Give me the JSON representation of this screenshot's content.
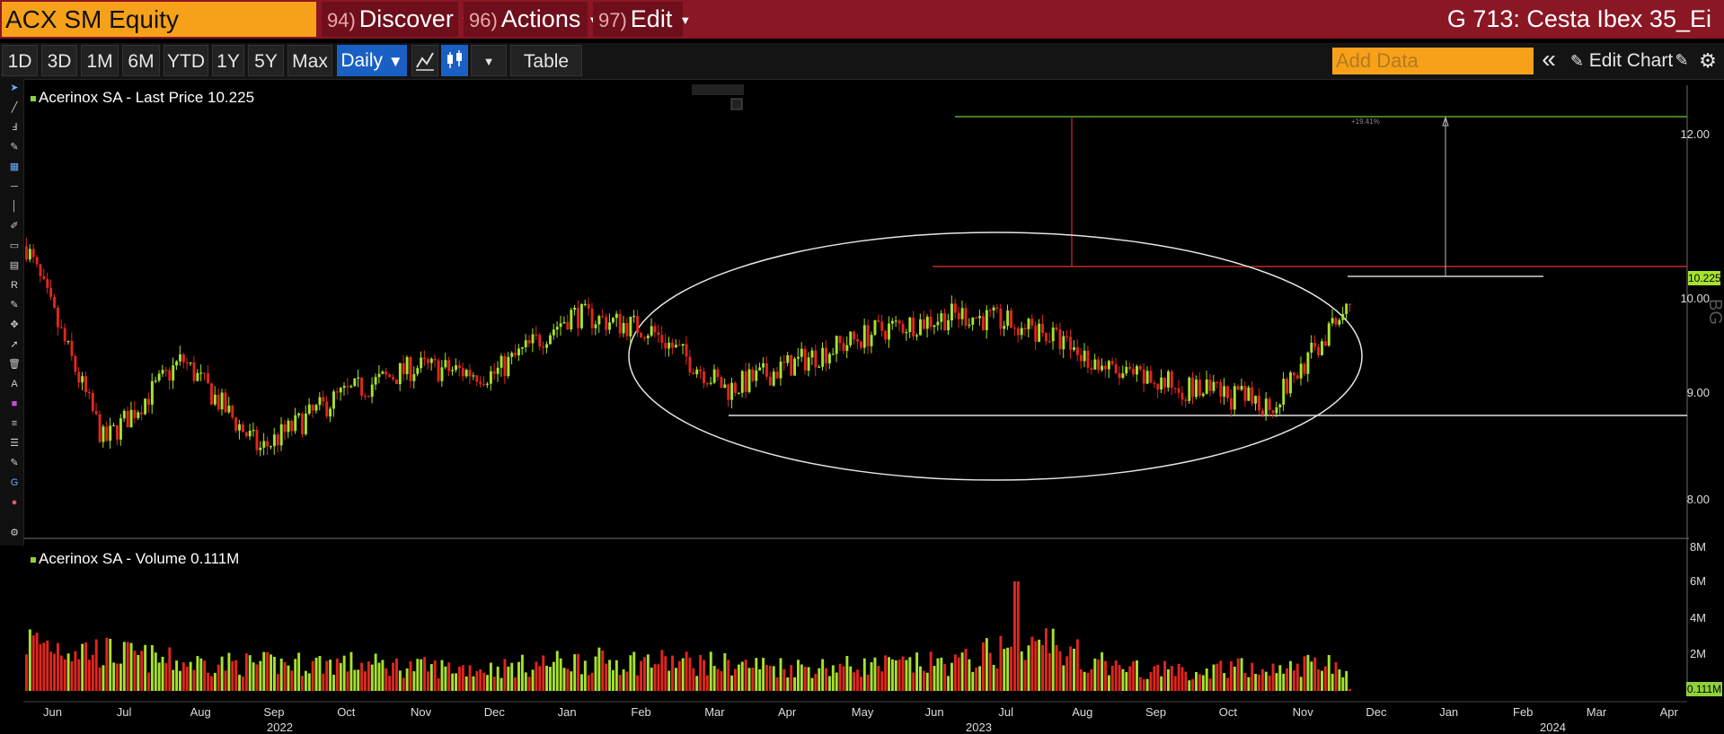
{
  "header": {
    "ticker_value": "ACX SM Equity",
    "menus": [
      {
        "num": "94)",
        "label": "Discover"
      },
      {
        "num": "96)",
        "label": "Actions"
      },
      {
        "num": "97)",
        "label": "Edit"
      }
    ],
    "chart_title": "G 713: Cesta Ibex 35_Ei"
  },
  "toolbar": {
    "ranges": [
      "1D",
      "3D",
      "1M",
      "6M",
      "YTD",
      "1Y",
      "5Y",
      "Max"
    ],
    "frequency": "Daily",
    "frequency_caret": "▼",
    "table_label": "Table",
    "add_data_placeholder": "Add Data",
    "collapse_icon": "«",
    "edit_chart_label": "Edit Chart",
    "colors": {
      "accent": "#1a5fc4",
      "orange": "#f7a11a",
      "brand": "#8b1624"
    }
  },
  "price_panel": {
    "legend": "Acerinox SA - Last Price 10.225",
    "last_label": "10.225",
    "annotation": "+19.41%",
    "y_ticks": [
      "12.00",
      "10.00",
      "9.00",
      "8.00"
    ],
    "watermark": "BG"
  },
  "volume_panel": {
    "legend": "Acerinox SA - Volume 0.111M",
    "last_label": "0.111M",
    "y_ticks": [
      "8M",
      "6M",
      "4M",
      "2M"
    ]
  },
  "x_axis": {
    "months": [
      "Jun",
      "Jul",
      "Aug",
      "Sep",
      "Oct",
      "Nov",
      "Dec",
      "Jan",
      "Feb",
      "Mar",
      "Apr",
      "May",
      "Jun",
      "Jul",
      "Aug",
      "Sep",
      "Oct",
      "Nov",
      "Dec",
      "Jan",
      "Feb",
      "Mar",
      "Apr"
    ],
    "years": [
      "2022",
      "2023",
      "2024"
    ]
  },
  "chart_data": [
    {
      "type": "line",
      "title": "Acerinox SA - Last Price 10.225",
      "y_unit": "EUR",
      "ylim": [
        7.6,
        12.6
      ],
      "x": [
        "2022-06",
        "2022-07",
        "2022-08",
        "2022-09",
        "2022-10",
        "2022-11",
        "2022-12",
        "2023-01",
        "2023-02",
        "2023-03",
        "2023-04",
        "2023-05",
        "2023-06",
        "2023-07",
        "2023-08",
        "2023-09",
        "2023-10",
        "2023-11"
      ],
      "series": [
        {
          "name": "Acerinox SA",
          "values": [
            11.0,
            8.4,
            9.5,
            8.3,
            9.0,
            9.4,
            9.3,
            10.1,
            9.9,
            9.1,
            9.5,
            9.9,
            10.1,
            9.9,
            9.3,
            9.1,
            8.9,
            10.2
          ]
        }
      ],
      "last": 10.225
    },
    {
      "type": "bar",
      "title": "Acerinox SA - Volume 0.111M",
      "y_unit": "M",
      "ylim": [
        0,
        8
      ],
      "x": [
        "2022-06",
        "2022-07",
        "2022-08",
        "2022-09",
        "2022-10",
        "2022-11",
        "2022-12",
        "2023-01",
        "2023-02",
        "2023-03",
        "2023-04",
        "2023-05",
        "2023-06",
        "2023-07",
        "2023-08",
        "2023-09",
        "2023-10",
        "2023-11"
      ],
      "series": [
        {
          "name": "Volume",
          "values": [
            3.4,
            2.6,
            1.9,
            1.8,
            1.9,
            1.6,
            1.5,
            2.0,
            2.0,
            1.8,
            1.6,
            1.7,
            1.9,
            3.6,
            1.5,
            1.3,
            1.7,
            1.7
          ]
        }
      ],
      "last": 0.111
    }
  ]
}
